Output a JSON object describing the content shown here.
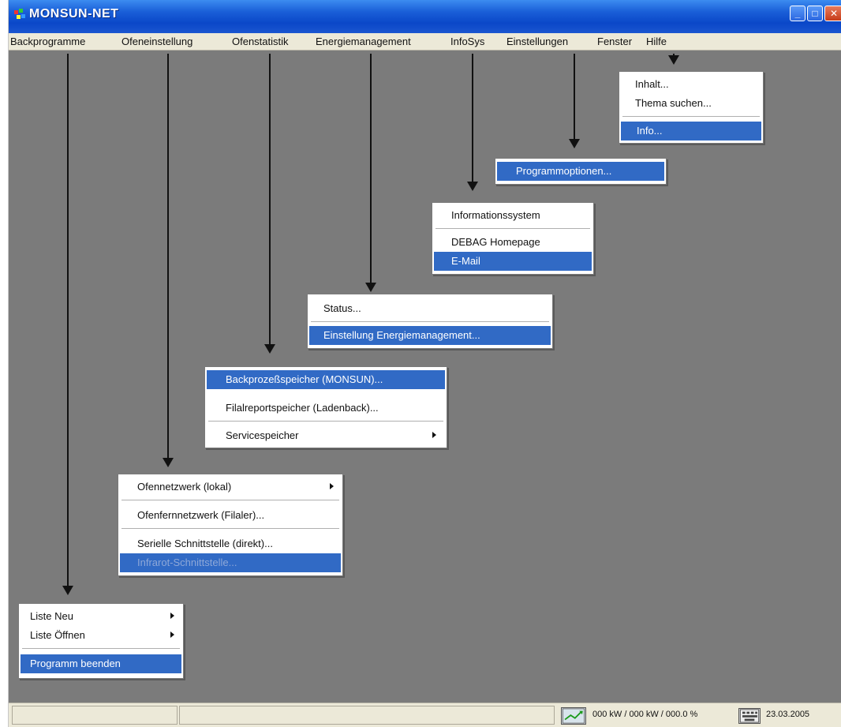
{
  "window": {
    "title": "MONSUN-NET",
    "controls": [
      "minimize-icon",
      "maximize-icon",
      "close-icon"
    ]
  },
  "menubar": {
    "items": [
      {
        "label": "Backprogramme"
      },
      {
        "label": "Ofeneinstellung"
      },
      {
        "label": "Ofenstatistik"
      },
      {
        "label": "Energiemanagement"
      },
      {
        "label": "InfoSys"
      },
      {
        "label": "Einstellungen"
      },
      {
        "label": "Fenster"
      },
      {
        "label": "Hilfe"
      }
    ]
  },
  "menus": {
    "hilfe": {
      "items": [
        {
          "label": "Inhalt..."
        },
        {
          "label": "Thema suchen..."
        },
        {
          "label": "Info..."
        }
      ]
    },
    "einstellungen": {
      "items": [
        {
          "label": "Programmoptionen..."
        }
      ]
    },
    "infosys": {
      "items": [
        {
          "label": "Informationssystem"
        },
        {
          "label": "DEBAG Homepage"
        },
        {
          "label": "E-Mail"
        }
      ]
    },
    "energiemanagement": {
      "items": [
        {
          "label": "Status..."
        },
        {
          "label": "Einstellung Energiemanagement..."
        }
      ]
    },
    "ofenstatistik": {
      "items": [
        {
          "label": "Backprozeßspeicher (MONSUN)..."
        },
        {
          "label": "Filalreportspeicher (Ladenback)..."
        },
        {
          "label": "Servicespeicher"
        }
      ]
    },
    "ofeneinstellung": {
      "items": [
        {
          "label": "Ofennetzwerk (lokal)"
        },
        {
          "label": "Ofenfernnetzwerk (Filaler)..."
        },
        {
          "label": "Serielle Schnittstelle (direkt)..."
        },
        {
          "label": "Infrarot-Schnittstelle..."
        }
      ]
    },
    "backprogramme": {
      "items": [
        {
          "label": "Liste Neu"
        },
        {
          "label": "Liste Öffnen"
        },
        {
          "label": "Programm beenden"
        }
      ]
    }
  },
  "statusbar": {
    "energy": "000 kW / 000 kW / 000.0 %",
    "date": "23.03.2005",
    "energy_icon": "energy-gauge-icon",
    "keyboard_icon": "keyboard-icon"
  },
  "colors": {
    "titlebar": "#0a47c8",
    "background": "#7b7b7b",
    "menubar": "#ece9d8",
    "selection": "#316ac5"
  }
}
